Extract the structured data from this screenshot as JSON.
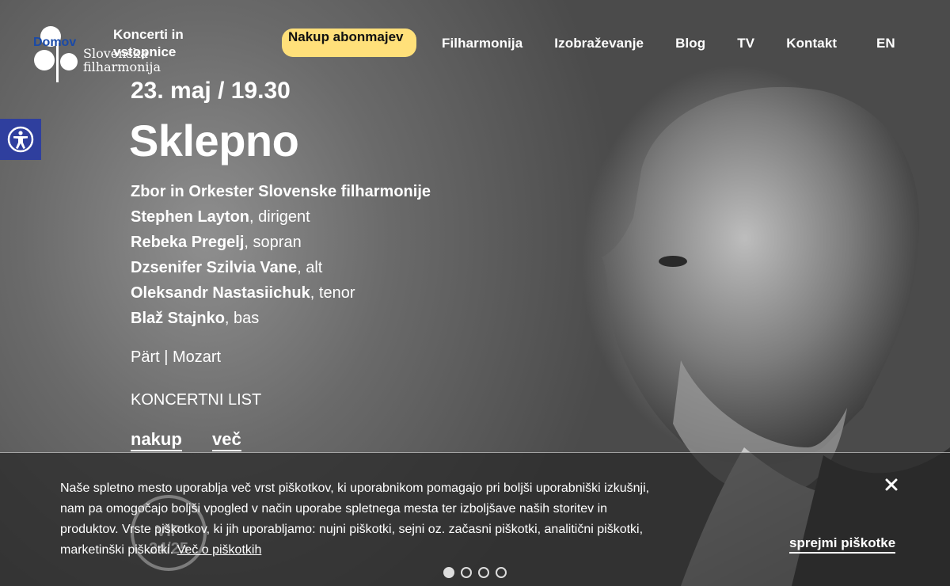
{
  "header": {
    "logo_text": "Slovenska filharmonija",
    "skip_home": "Domov",
    "nav_concerts": "Koncerti in vstopnice",
    "nav_subscriptions": "Nakup abonmajev",
    "nav_items": [
      "Filharmonija",
      "Izobraževanje",
      "Blog",
      "TV",
      "Kontakt"
    ],
    "language": "EN"
  },
  "hero": {
    "date": "23. maj / 19.30",
    "title": "Sklepno",
    "performers": [
      {
        "name": "Zbor in Orkester Slovenske filharmonije",
        "role": ""
      },
      {
        "name": "Stephen Layton",
        "role": ", dirigent"
      },
      {
        "name": "Rebeka Pregelj",
        "role": ", sopran"
      },
      {
        "name": "Dzsenifer Szilvia Vane",
        "role": ", alt"
      },
      {
        "name": "Oleksandr Nastasiichuk",
        "role": ", tenor"
      },
      {
        "name": "Blaž Stajnko",
        "role": ", bas"
      }
    ],
    "composers": "Pärt | Mozart",
    "program_link": "KONCERTNI LIST",
    "buy_label": "nakup",
    "more_label": "več"
  },
  "cookie": {
    "text": "Naše spletno mesto uporablja več vrst piškotkov, ki uporabnikom pomagajo pri boljši uporabniški izkušnji, nam pa omogočajo boljši vpogled v način uporabe spletnega mesta ter izboljšave naših storitev in produktov. Vrste piškotkov, ki jih uporabljamo: nujni piškotki, sejni oz. začasni piškotki, analitični piškotki, marketinški piškotki.",
    "more_link": "Več o piškotkih",
    "accept": "sprejmi piškotke",
    "badge": "VIP 24/25"
  },
  "carousel": {
    "slides": 4,
    "active": 1
  },
  "colors": {
    "accent_yellow": "#ffe07a",
    "accessibility_blue": "#2f3f9e",
    "skip_link_blue": "#1a4aa8"
  }
}
